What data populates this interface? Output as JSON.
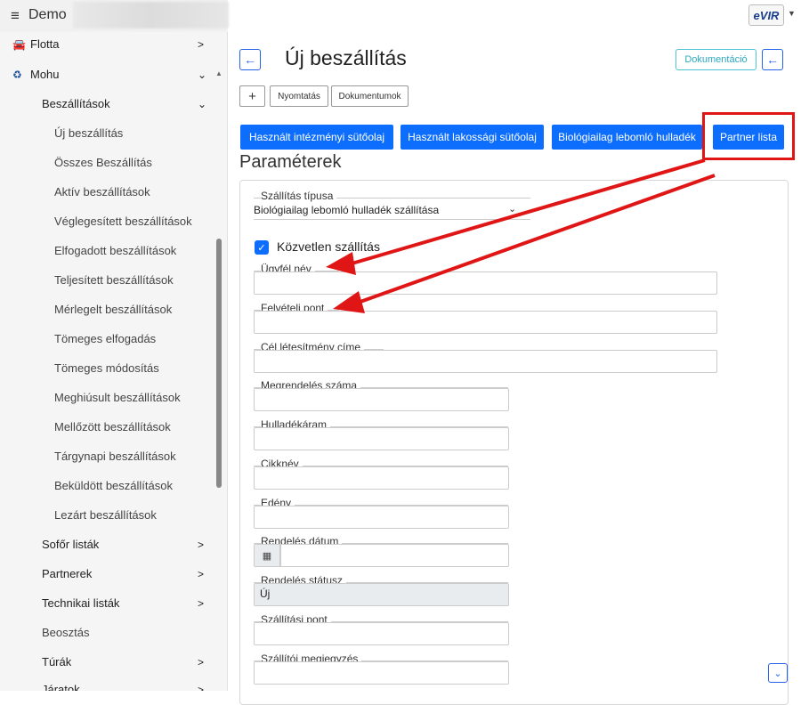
{
  "topbar": {
    "menu_icon": "hamburger-icon",
    "app_title": "Demo",
    "logo_text": "eVIR"
  },
  "sidebar": {
    "items": [
      {
        "label": "Flotta",
        "icon": "car-icon"
      },
      {
        "label": "Mohu",
        "icon": "recycle-icon"
      },
      {
        "label": "Beszállítások"
      },
      {
        "label": "Új beszállítás"
      },
      {
        "label": "Összes Beszállítás"
      },
      {
        "label": "Aktív beszállítások"
      },
      {
        "label": "Véglegesített beszállítások"
      },
      {
        "label": "Elfogadott beszállítások"
      },
      {
        "label": "Teljesített beszállítások"
      },
      {
        "label": "Mérlegelt beszállítások"
      },
      {
        "label": "Tömeges elfogadás"
      },
      {
        "label": "Tömeges módosítás"
      },
      {
        "label": "Meghiúsult beszállítások"
      },
      {
        "label": "Mellőzött beszállítások"
      },
      {
        "label": "Tárgynapi beszállítások"
      },
      {
        "label": "Beküldött beszállítások"
      },
      {
        "label": "Lezárt beszállítások"
      },
      {
        "label": "Sofőr listák"
      },
      {
        "label": "Partnerek"
      },
      {
        "label": "Technikai listák"
      },
      {
        "label": "Beosztás"
      },
      {
        "label": "Túrák"
      },
      {
        "label": "Járatok"
      }
    ]
  },
  "main": {
    "title": "Új beszállítás",
    "doc_button": "Dokumentáció",
    "toolbar": {
      "add": "+",
      "print": "Nyomtatás",
      "documents": "Dokumentumok"
    },
    "actions": [
      "Használt intézményi sütőolaj",
      "Használt lakossági sütőolaj",
      "Biológiailag lebomló hulladék",
      "Partner lista"
    ],
    "section_title": "Paraméterek",
    "form": {
      "shipping_type_label": "Szállítás típusa",
      "shipping_type_value": "Biológiailag lebomló hulladék szállítása",
      "direct_label": "Közvetlen szállítás",
      "direct_checked": true,
      "client_label": "Ügyfél név",
      "pickup_label": "Felvételi pont",
      "target_label": "Cél létesítmény címe",
      "order_no_label": "Megrendelés száma",
      "waste_stream_label": "Hulladékáram",
      "item_label": "Cikknév",
      "container_label": "Edény",
      "order_date_label": "Rendelés dátum",
      "order_status_label": "Rendelés státusz",
      "order_status_value": "Új",
      "delivery_point_label": "Szállítási pont",
      "carrier_note_label": "Szállítói megjegyzés"
    }
  },
  "annotation": {
    "color": "#e01616"
  }
}
